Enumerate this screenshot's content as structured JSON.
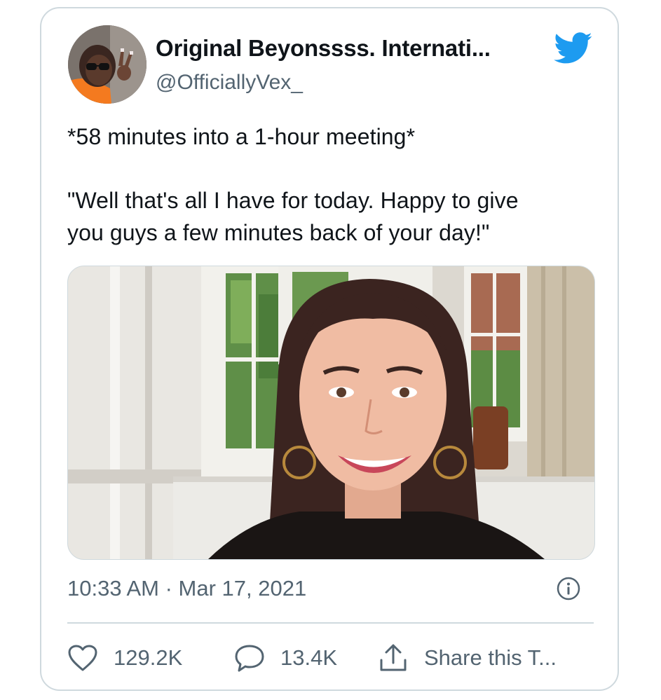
{
  "tweet": {
    "author_name": "Original Beyonssss. Internati...",
    "author_handle": "@OfficiallyVex_",
    "text_line1": "*58 minutes into a 1-hour meeting*",
    "text_line2": "\"Well that's all I have for today. Happy to give",
    "text_line3": "you guys a few minutes back of your day!\"",
    "timestamp": "10:33 AM · Mar 17, 2021",
    "likes": "129.2K",
    "replies": "13.4K",
    "share_label": "Share this T..."
  },
  "icons": {
    "brand": "twitter-bird-icon",
    "info": "info-icon",
    "like": "heart-icon",
    "reply": "speech-bubble-icon",
    "share": "share-upload-icon"
  },
  "colors": {
    "brand_blue": "#1d9bf0",
    "text_primary": "#0f1419",
    "text_secondary": "#536471",
    "border": "#cfd9de"
  }
}
